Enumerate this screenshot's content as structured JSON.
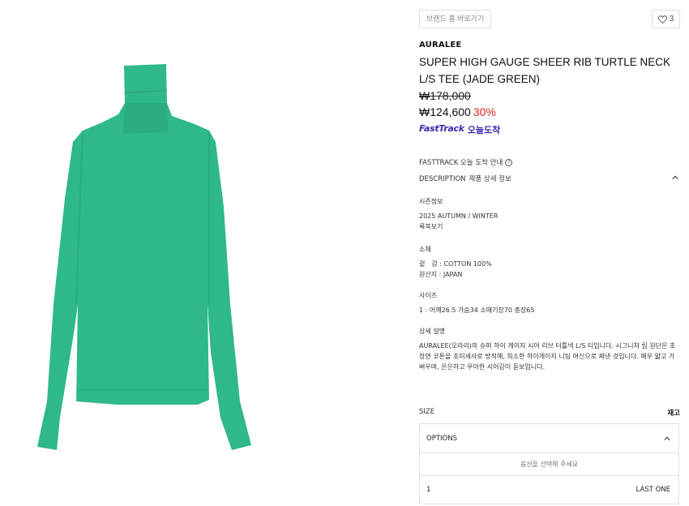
{
  "header": {
    "brand_home_label": "브랜드 홈 바로가기",
    "like_count": "3"
  },
  "product": {
    "brand": "AURALEE",
    "title": "SUPER HIGH GAUGE SHEER RIB TURTLE NECK L/S TEE (JADE GREEN)",
    "original_price": "₩178,000",
    "sale_price": "₩124,600",
    "discount": "30%",
    "fasttrack_logo": "FastTrack",
    "fasttrack_today": "오늘도착",
    "image_color": "#2fb88a"
  },
  "info": {
    "fasttrack_guide": "FASTTRACK 오늘 도착 안내",
    "description_title": "DESCRIPTION",
    "description_sub": "제품 상세 정보",
    "season_head": "시즌정보",
    "season_value": "2025 AUTUMN / WINTER",
    "lookbook_link": "룩북보기",
    "material_head": "소재",
    "material_line1": "겉　감 : COTTON 100%",
    "material_line2": "원산지 : JAPAN",
    "size_head": "사이즈",
    "size_line": "1 : 어깨26.5 가슴34 소매기장70 총장65",
    "detail_head": "상세 설명",
    "detail_text": "AURALEE(오라리)의 슈퍼 하이 게이지 시어 리브 터틀넥 L/S 티입니다. 시그니처 립 원단은 초장면 코튼을 초미세사로 방적해, 희소한 하이게이지 니팅 머신으로 짜낸 것입니다. 매우 얇고 가벼우며, 은은하고 우아한 시어감이 돋보입니다."
  },
  "purchase": {
    "size_label": "SIZE",
    "stock_label": "재고",
    "options_label": "OPTIONS",
    "options_placeholder": "옵션을 선택해 주세요",
    "option_items": [
      {
        "size": "1",
        "stock": "LAST ONE"
      }
    ]
  }
}
